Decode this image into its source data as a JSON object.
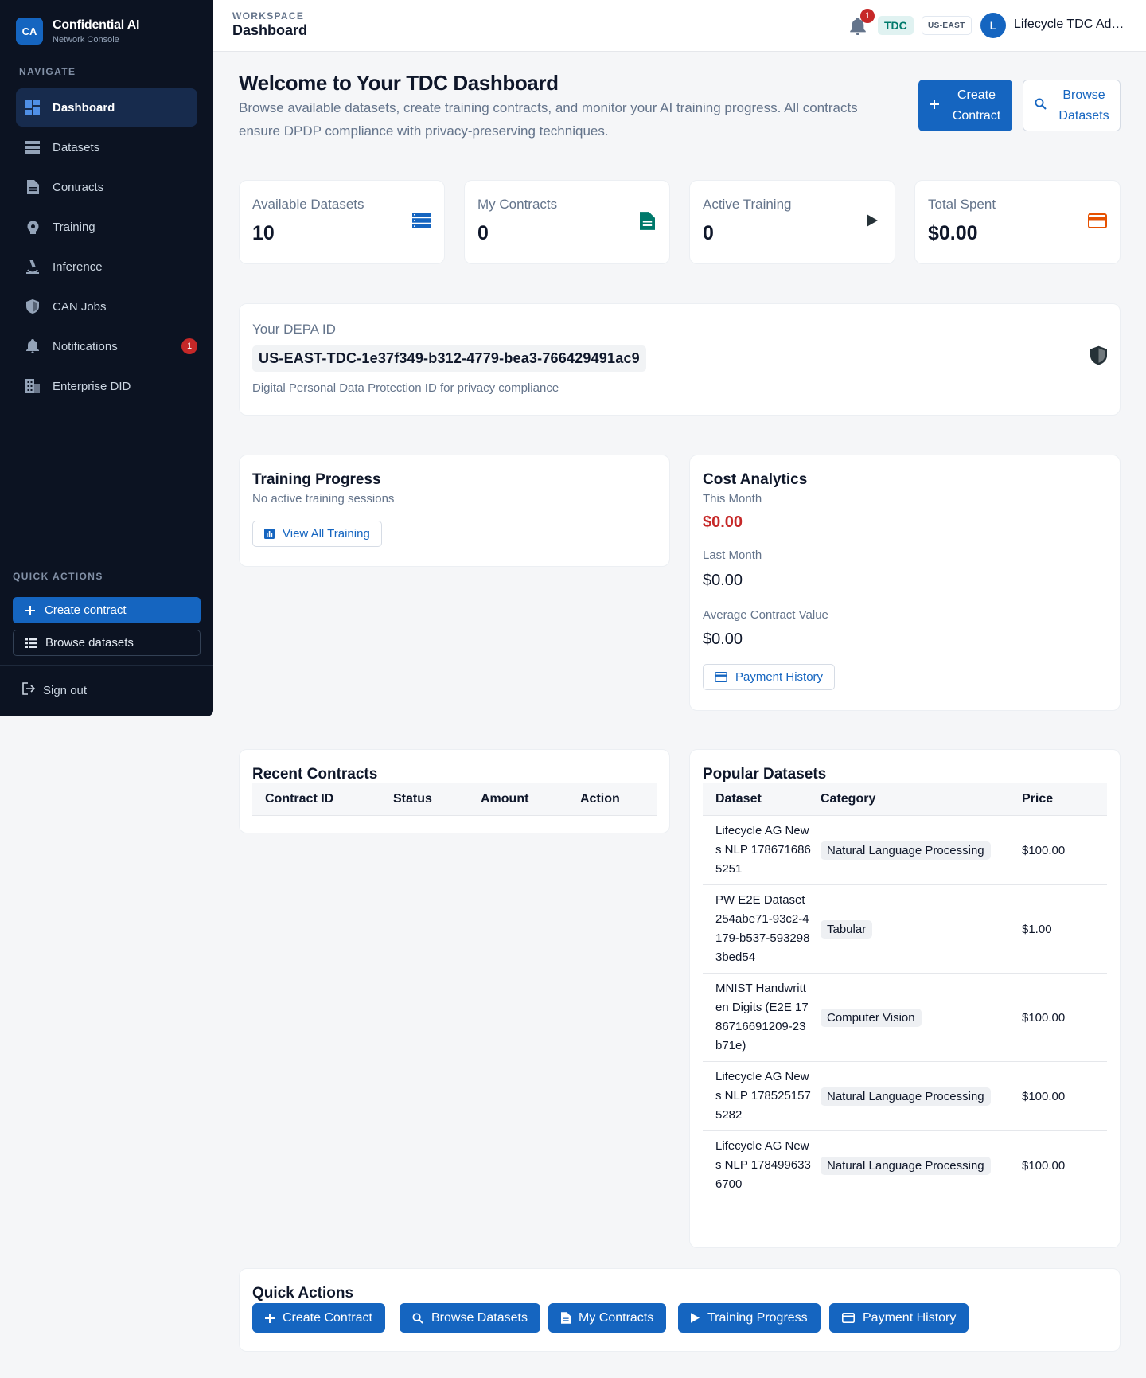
{
  "brand": {
    "logo": "CA",
    "name": "Confidential AI",
    "subtitle": "Network Console"
  },
  "sidebar": {
    "nav_heading": "NAVIGATE",
    "items": [
      {
        "label": "Dashboard",
        "icon": "dashboard-icon",
        "active": true
      },
      {
        "label": "Datasets",
        "icon": "list-icon"
      },
      {
        "label": "Contracts",
        "icon": "document-icon"
      },
      {
        "label": "Training",
        "icon": "brain-icon"
      },
      {
        "label": "Inference",
        "icon": "microscope-icon"
      },
      {
        "label": "CAN Jobs",
        "icon": "shield-icon"
      },
      {
        "label": "Notifications",
        "icon": "bell-icon",
        "badge": "1"
      },
      {
        "label": "Enterprise DID",
        "icon": "building-icon"
      }
    ],
    "quick_heading": "QUICK ACTIONS",
    "create_contract": "Create contract",
    "browse_datasets": "Browse datasets",
    "sign_out": "Sign out"
  },
  "header": {
    "kicker": "WORKSPACE",
    "title": "Dashboard",
    "notification_count": "1",
    "role_chip": "TDC",
    "region_chip": "US-EAST",
    "avatar_initial": "L",
    "user_name": "Lifecycle TDC Admin"
  },
  "welcome": {
    "title": "Welcome to Your TDC Dashboard",
    "subtitle": "Browse available datasets, create training contracts, and monitor your AI training progress. All contracts ensure DPDP compliance with privacy-preserving techniques.",
    "create_line1": "Create",
    "create_line2": "Contract",
    "browse_line1": "Browse",
    "browse_line2": "Datasets"
  },
  "stats": [
    {
      "label": "Available Datasets",
      "value": "10",
      "icon": "list-icon",
      "color": "#1565c0"
    },
    {
      "label": "My Contracts",
      "value": "0",
      "icon": "document-icon",
      "color": "#00796b"
    },
    {
      "label": "Active Training",
      "value": "0",
      "icon": "play-icon",
      "color": "#263238"
    },
    {
      "label": "Total Spent",
      "value": "$0.00",
      "icon": "credit-card-icon",
      "color": "#e65100"
    }
  ],
  "depa": {
    "label": "Your DEPA ID",
    "id": "US-EAST-TDC-1e37f349-b312-4779-bea3-766429491ac9",
    "help": "Digital Personal Data Protection ID for privacy compliance"
  },
  "training_progress": {
    "title": "Training Progress",
    "subtitle": "No active training sessions",
    "button": "View All Training"
  },
  "cost_analytics": {
    "title": "Cost Analytics",
    "this_month_label": "This Month",
    "this_month_value": "$0.00",
    "last_month_label": "Last Month",
    "last_month_value": "$0.00",
    "avg_label": "Average Contract Value",
    "avg_value": "$0.00",
    "button": "Payment History"
  },
  "recent_contracts": {
    "title": "Recent Contracts",
    "columns": [
      "Contract ID",
      "Status",
      "Amount",
      "Action"
    ]
  },
  "popular_datasets": {
    "title": "Popular Datasets",
    "columns": [
      "Dataset",
      "Category",
      "Price"
    ],
    "rows": [
      {
        "name": "Lifecycle AG News NLP 1786716865251",
        "category": "Natural Language Processing",
        "price": "$100.00"
      },
      {
        "name": "PW E2E Dataset 254abe71-93c2-4179-b537-5932983bed54",
        "category": "Tabular",
        "price": "$1.00"
      },
      {
        "name": "MNIST Handwritten Digits (E2E 1786716691209-23b71e)",
        "category": "Computer Vision",
        "price": "$100.00"
      },
      {
        "name": "Lifecycle AG News NLP 1785251575282",
        "category": "Natural Language Processing",
        "price": "$100.00"
      },
      {
        "name": "Lifecycle AG News NLP 1784996336700",
        "category": "Natural Language Processing",
        "price": "$100.00"
      }
    ]
  },
  "quick_actions": {
    "title": "Quick Actions",
    "buttons": [
      {
        "label": "Create Contract",
        "icon": "plus-icon"
      },
      {
        "label": "Browse Datasets",
        "icon": "search-icon"
      },
      {
        "label": "My Contracts",
        "icon": "document-icon"
      },
      {
        "label": "Training Progress",
        "icon": "play-icon"
      },
      {
        "label": "Payment History",
        "icon": "credit-card-icon"
      }
    ]
  }
}
